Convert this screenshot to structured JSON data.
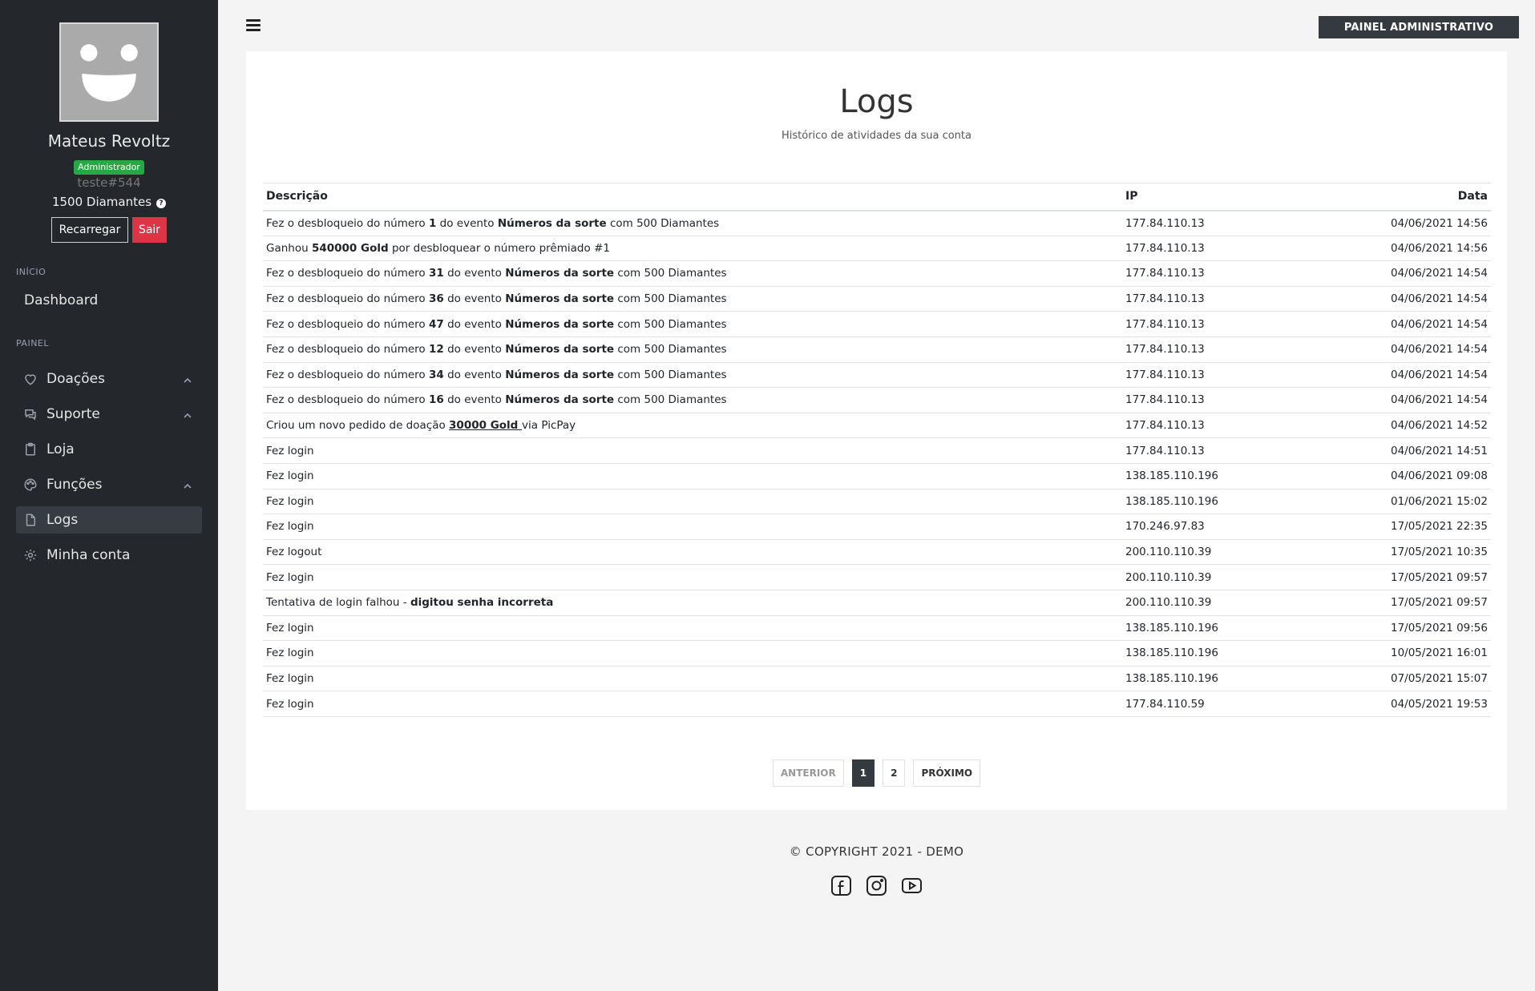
{
  "user": {
    "name": "Mateus Revoltz",
    "role": "Administrador",
    "tag": "teste#544",
    "diamonds": "1500 Diamantes",
    "reload_label": "Recarregar",
    "exit_label": "Sair"
  },
  "sidebar": {
    "sections": [
      "INÍCIO",
      "PAINEL"
    ],
    "dashboard": "Dashboard",
    "items": [
      {
        "label": "Doações",
        "icon": "heart-icon",
        "expandable": true
      },
      {
        "label": "Suporte",
        "icon": "chat-icon",
        "expandable": true
      },
      {
        "label": "Loja",
        "icon": "clipboard-icon",
        "expandable": false
      },
      {
        "label": "Funções",
        "icon": "palette-icon",
        "expandable": true
      },
      {
        "label": "Logs",
        "icon": "file-icon",
        "expandable": false,
        "active": true
      },
      {
        "label": "Minha conta",
        "icon": "gear-icon",
        "expandable": false
      }
    ]
  },
  "header": {
    "admin_button": "PAINEL ADMINISTRATIVO"
  },
  "page": {
    "title": "Logs",
    "subtitle": "Histórico de atividades da sua conta"
  },
  "table": {
    "headers": [
      "Descrição",
      "IP",
      "Data"
    ],
    "rows": [
      {
        "desc": [
          {
            "t": "Fez o desbloqueio do número "
          },
          {
            "t": "1",
            "b": true
          },
          {
            "t": " do evento "
          },
          {
            "t": "Números da sorte",
            "b": true
          },
          {
            "t": " com 500 Diamantes"
          }
        ],
        "ip": "177.84.110.13",
        "date": "04/06/2021 14:56"
      },
      {
        "desc": [
          {
            "t": "Ganhou "
          },
          {
            "t": "540000 Gold",
            "b": true
          },
          {
            "t": " por desbloquear o número prêmiado #1"
          }
        ],
        "ip": "177.84.110.13",
        "date": "04/06/2021 14:56"
      },
      {
        "desc": [
          {
            "t": "Fez o desbloqueio do número "
          },
          {
            "t": "31",
            "b": true
          },
          {
            "t": " do evento "
          },
          {
            "t": "Números da sorte",
            "b": true
          },
          {
            "t": " com 500 Diamantes"
          }
        ],
        "ip": "177.84.110.13",
        "date": "04/06/2021 14:54"
      },
      {
        "desc": [
          {
            "t": "Fez o desbloqueio do número "
          },
          {
            "t": "36",
            "b": true
          },
          {
            "t": " do evento "
          },
          {
            "t": "Números da sorte",
            "b": true
          },
          {
            "t": " com 500 Diamantes"
          }
        ],
        "ip": "177.84.110.13",
        "date": "04/06/2021 14:54"
      },
      {
        "desc": [
          {
            "t": "Fez o desbloqueio do número "
          },
          {
            "t": "47",
            "b": true
          },
          {
            "t": " do evento "
          },
          {
            "t": "Números da sorte",
            "b": true
          },
          {
            "t": " com 500 Diamantes"
          }
        ],
        "ip": "177.84.110.13",
        "date": "04/06/2021 14:54"
      },
      {
        "desc": [
          {
            "t": "Fez o desbloqueio do número "
          },
          {
            "t": "12",
            "b": true
          },
          {
            "t": " do evento "
          },
          {
            "t": "Números da sorte",
            "b": true
          },
          {
            "t": " com 500 Diamantes"
          }
        ],
        "ip": "177.84.110.13",
        "date": "04/06/2021 14:54"
      },
      {
        "desc": [
          {
            "t": "Fez o desbloqueio do número "
          },
          {
            "t": "34",
            "b": true
          },
          {
            "t": " do evento "
          },
          {
            "t": "Números da sorte",
            "b": true
          },
          {
            "t": " com 500 Diamantes"
          }
        ],
        "ip": "177.84.110.13",
        "date": "04/06/2021 14:54"
      },
      {
        "desc": [
          {
            "t": "Fez o desbloqueio do número "
          },
          {
            "t": "16",
            "b": true
          },
          {
            "t": " do evento "
          },
          {
            "t": "Números da sorte",
            "b": true
          },
          {
            "t": " com 500 Diamantes"
          }
        ],
        "ip": "177.84.110.13",
        "date": "04/06/2021 14:54"
      },
      {
        "desc": [
          {
            "t": "Criou um novo pedido de doação "
          },
          {
            "t": "30000 Gold ",
            "u": true
          },
          {
            "t": "via PicPay"
          }
        ],
        "ip": "177.84.110.13",
        "date": "04/06/2021 14:52"
      },
      {
        "desc": [
          {
            "t": "Fez login"
          }
        ],
        "ip": "177.84.110.13",
        "date": "04/06/2021 14:51"
      },
      {
        "desc": [
          {
            "t": "Fez login"
          }
        ],
        "ip": "138.185.110.196",
        "date": "04/06/2021 09:08"
      },
      {
        "desc": [
          {
            "t": "Fez login"
          }
        ],
        "ip": "138.185.110.196",
        "date": "01/06/2021 15:02"
      },
      {
        "desc": [
          {
            "t": "Fez login"
          }
        ],
        "ip": "170.246.97.83",
        "date": "17/05/2021 22:35"
      },
      {
        "desc": [
          {
            "t": "Fez logout"
          }
        ],
        "ip": "200.110.110.39",
        "date": "17/05/2021 10:35"
      },
      {
        "desc": [
          {
            "t": "Fez login"
          }
        ],
        "ip": "200.110.110.39",
        "date": "17/05/2021 09:57"
      },
      {
        "desc": [
          {
            "t": "Tentativa de login falhou - "
          },
          {
            "t": "digitou senha incorreta",
            "b": true
          }
        ],
        "ip": "200.110.110.39",
        "date": "17/05/2021 09:57"
      },
      {
        "desc": [
          {
            "t": "Fez login"
          }
        ],
        "ip": "138.185.110.196",
        "date": "17/05/2021 09:56"
      },
      {
        "desc": [
          {
            "t": "Fez login"
          }
        ],
        "ip": "138.185.110.196",
        "date": "10/05/2021 16:01"
      },
      {
        "desc": [
          {
            "t": "Fez login"
          }
        ],
        "ip": "138.185.110.196",
        "date": "07/05/2021 15:07"
      },
      {
        "desc": [
          {
            "t": "Fez login"
          }
        ],
        "ip": "177.84.110.59",
        "date": "04/05/2021 19:53"
      }
    ]
  },
  "pagination": {
    "prev": "ANTERIOR",
    "pages": [
      "1",
      "2"
    ],
    "current": "1",
    "next": "PRÓXIMO"
  },
  "footer": {
    "copyright": "© COPYRIGHT 2021 - DEMO",
    "socials": [
      "facebook-icon",
      "instagram-icon",
      "youtube-icon"
    ]
  },
  "colors": {
    "sidebar_bg": "#24282d",
    "badge_green": "#28a745",
    "exit_red": "#dc3545",
    "admin_btn": "#343a40"
  }
}
